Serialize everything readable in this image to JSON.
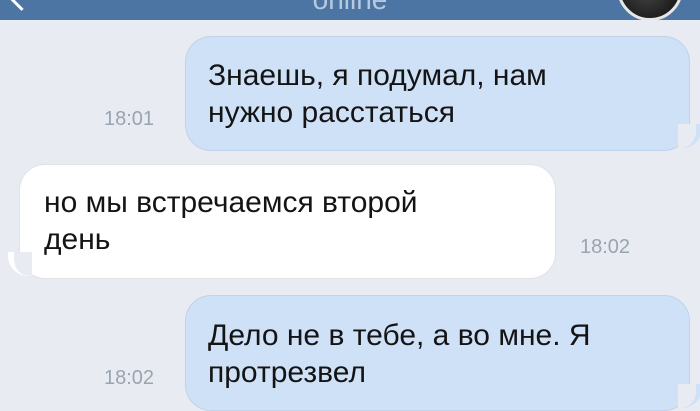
{
  "header": {
    "status": "online"
  },
  "messages": [
    {
      "direction": "outgoing",
      "text": "Знаешь, я подумал, нам\nнужно расстаться",
      "time": "18:01"
    },
    {
      "direction": "incoming",
      "text": "но мы встречаемся второй\nдень",
      "time": "18:02"
    },
    {
      "direction": "outgoing",
      "text": "Дело не в тебе, а во мне. Я\nпротрезвел",
      "time": "18:02"
    }
  ],
  "colors": {
    "header": "#4d75a3",
    "background": "#e8ecf2",
    "outgoing_bubble": "#cfe1f7",
    "incoming_bubble": "#ffffff",
    "time_text": "#9aa4af"
  }
}
